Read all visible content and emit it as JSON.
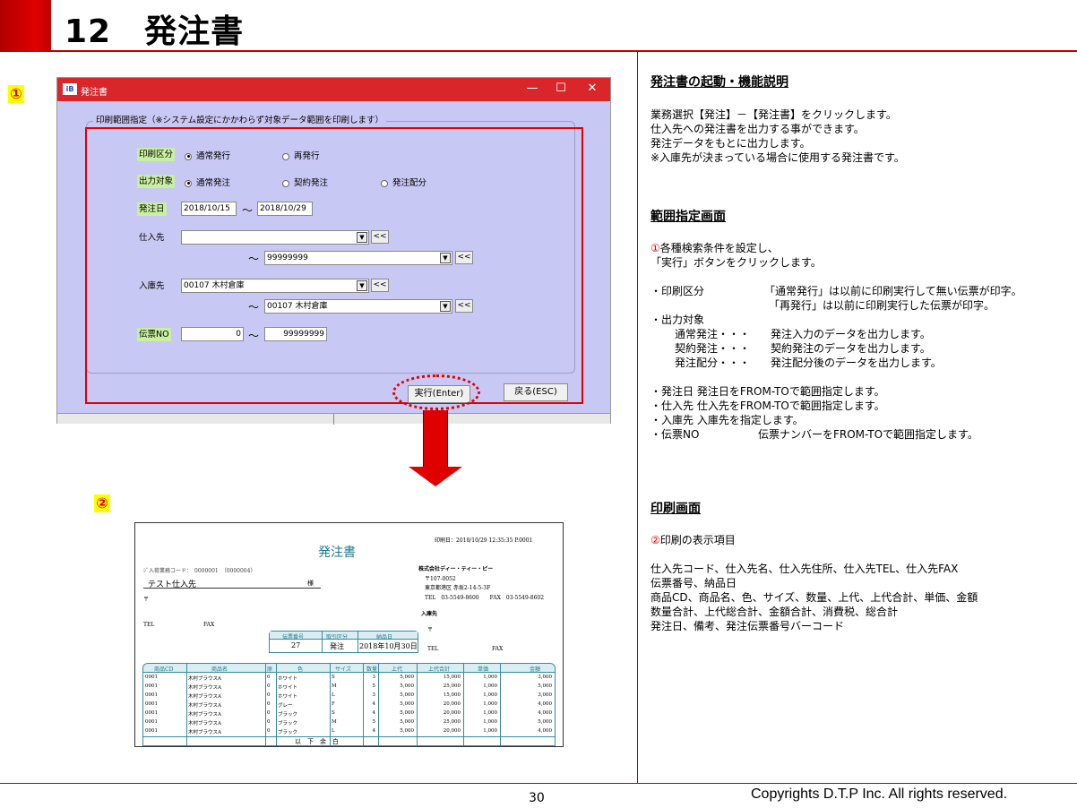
{
  "header": {
    "title": "12　発注書"
  },
  "markers": {
    "one": "①",
    "two": "②"
  },
  "window": {
    "title": "発注書",
    "icon": "iB",
    "controls": {
      "minimize": "—",
      "maximize": "☐",
      "close": "✕"
    },
    "group_title": "印刷範囲指定（※システム設定にかかわらず対象データ範囲を印刷します）",
    "print_type": {
      "label": "印刷区分",
      "opt1": "通常発行",
      "opt2": "再発行"
    },
    "output_target": {
      "label": "出力対象",
      "opt1": "通常発注",
      "opt2": "契約発注",
      "opt3": "発注配分"
    },
    "order_date": {
      "label": "発注日",
      "from": "2018/10/15",
      "to": "2018/10/29",
      "tilde": "～"
    },
    "supplier": {
      "label": "仕入先",
      "from": "",
      "to": "99999999",
      "back": "<<",
      "tilde": "～"
    },
    "warehouse": {
      "label": "入庫先",
      "from": "00107 木村倉庫",
      "to": "00107 木村倉庫",
      "back": "<<",
      "tilde": "～"
    },
    "slip_no": {
      "label": "伝票NO",
      "from": "0",
      "to": "99999999",
      "tilde": "～"
    },
    "buttons": {
      "run": "実行(Enter)",
      "back": "戻る(ESC)"
    }
  },
  "document": {
    "title": "発注書",
    "print_date": "印刷日：2018/10/29 12:35:35 P.0001",
    "supplier_code": "ｼﾞ入荷業務コード：　0000001　（0000004）",
    "supplier_name": "テスト仕入先",
    "sama": "様",
    "postal": "〒",
    "tel": "TEL",
    "fax": "FAX",
    "company": "株式会社ディー・ティー・ピー",
    "company_zip": "〒107-0052",
    "company_addr": "東京都港区 赤坂2-14-5-3F",
    "company_tel": "TEL　03-5549-8600　　FAX　03-5549-8602",
    "warehouse_label": "入庫先",
    "warehouse_postal": "〒",
    "warehouse_tel": "TEL",
    "warehouse_fax": "FAX",
    "mini_headers": [
      "伝票番号",
      "取引区分",
      "納品日"
    ],
    "mini_values": [
      "27",
      "発注",
      "2018年10月30日"
    ],
    "table_headers": [
      "商品CD",
      "商品名",
      "原",
      "色",
      "サイズ",
      "数量",
      "上代",
      "上代合計",
      "単価",
      "金額"
    ],
    "rows": [
      [
        "0001",
        "木村ブラウスA",
        "0",
        "ホワイト",
        "S",
        "3",
        "5,000",
        "15,000",
        "1,000",
        "3,000"
      ],
      [
        "0001",
        "木村ブラウスA",
        "0",
        "ホワイト",
        "M",
        "5",
        "5,000",
        "25,000",
        "1,000",
        "5,000"
      ],
      [
        "0001",
        "木村ブラウスA",
        "0",
        "ホワイト",
        "L",
        "3",
        "5,000",
        "15,000",
        "1,000",
        "3,000"
      ],
      [
        "0001",
        "木村ブラウスA",
        "0",
        "グレー",
        "F",
        "4",
        "5,000",
        "20,000",
        "1,000",
        "4,000"
      ],
      [
        "0001",
        "木村ブラウスA",
        "0",
        "ブラック",
        "S",
        "4",
        "5,000",
        "20,000",
        "1,000",
        "4,000"
      ],
      [
        "0001",
        "木村ブラウスA",
        "0",
        "ブラック",
        "M",
        "5",
        "5,000",
        "25,000",
        "1,000",
        "5,000"
      ],
      [
        "0001",
        "木村ブラウスA",
        "0",
        "ブラック",
        "L",
        "4",
        "5,000",
        "20,000",
        "1,000",
        "4,000"
      ]
    ],
    "footer_text": "以　下　余　白"
  },
  "right": {
    "sec1_title": "発注書の起動・機能説明",
    "sec1_lines": [
      "業務選択【発注】－【発注書】をクリックします。",
      "仕入先への発注書を出力する事ができます。",
      "発注データをもとに出力します。",
      "※入庫先が決まっている場合に使用する発注書です。"
    ],
    "sec2_title": "範囲指定画面",
    "sec2_circ": "①",
    "sec2_line1": "各種検索条件を設定し、",
    "sec2_line2": "「実行」ボタンをクリックします。",
    "pt_label": "・印刷区分",
    "pt_text1": "「通常発行」は以前に印刷実行して無い伝票が印字。",
    "pt_text2": "「再発行」は以前に印刷実行した伝票が印字。",
    "ot_label": "・出力対象",
    "ot_lines": [
      [
        "通常発注・・・",
        "発注入力のデータを出力します。"
      ],
      [
        "契約発注・・・",
        "契約発注のデータを出力します。"
      ],
      [
        "発注配分・・・",
        "発注配分後のデータを出力します。"
      ]
    ],
    "range_lines": [
      "・発注日 発注日をFROM-TOで範囲指定します。",
      "・仕入先 仕入先をFROM-TOで範囲指定します。",
      "・入庫先 入庫先を指定します。"
    ],
    "slip_label": "・伝票NO",
    "slip_text": "伝票ナンバーをFROM-TOで範囲指定します。",
    "sec3_title": "印刷画面",
    "sec3_circ": "②",
    "sec3_line1": "印刷の表示項目",
    "sec3_lines": [
      "仕入先コード、仕入先名、仕入先住所、仕入先TEL、仕入先FAX",
      "伝票番号、納品日",
      "商品CD、商品名、色、サイズ、数量、上代、上代合計、単価、金額",
      "数量合計、上代総合計、金額合計、消費税、総合計",
      "発注日、備考、発注伝票番号バーコード"
    ]
  },
  "footer": {
    "page": "30",
    "copyright": "Copyrights  D.T.P Inc. All rights reserved."
  }
}
